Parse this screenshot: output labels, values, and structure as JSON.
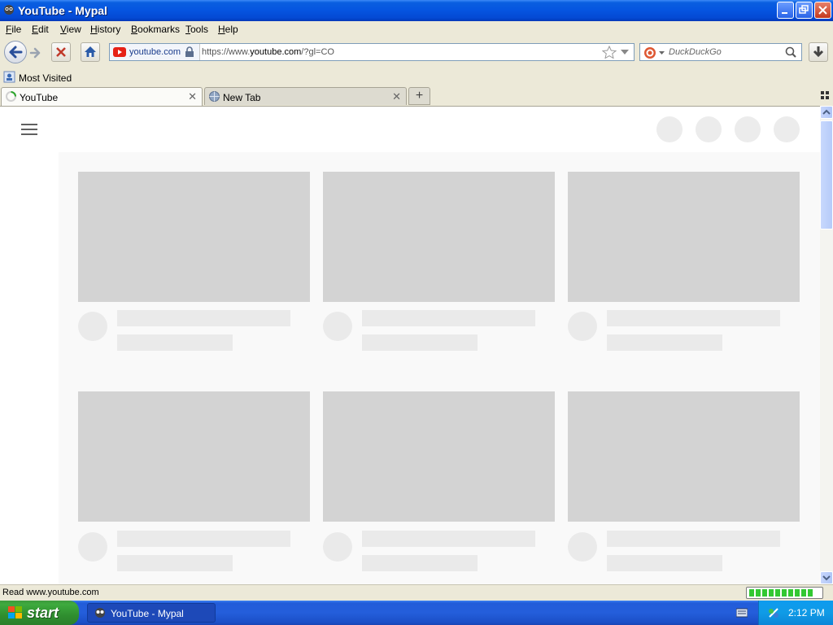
{
  "window": {
    "title": "YouTube - Mypal"
  },
  "menu": [
    {
      "label": "File",
      "key": "F",
      "rest": "ile"
    },
    {
      "label": "Edit",
      "key": "E",
      "rest": "dit"
    },
    {
      "label": "View",
      "key": "V",
      "rest": "iew"
    },
    {
      "label": "History",
      "key": "H",
      "rest": "istory"
    },
    {
      "label": "Bookmarks",
      "key": "B",
      "rest": "ookmarks"
    },
    {
      "label": "Tools",
      "key": "T",
      "rest": "ools"
    },
    {
      "label": "Help",
      "key": "H",
      "rest": "elp"
    }
  ],
  "navbar": {
    "identity_label": "youtube.com",
    "url_prefix": "https://www.",
    "url_domain": "youtube.com",
    "url_suffix": "/?gl=CO",
    "search_placeholder": "DuckDuckGo"
  },
  "bookmarks": {
    "most_visited": "Most Visited"
  },
  "tabs": [
    {
      "label": "YouTube",
      "active": true
    },
    {
      "label": "New Tab",
      "active": false
    }
  ],
  "status": {
    "text": "Read www.youtube.com",
    "progress_segments_filled": 10
  },
  "taskbar": {
    "start_label": "start",
    "task_label": "YouTube - Mypal",
    "clock": "2:12 PM"
  },
  "colors": {
    "accent": "#0554e0",
    "start_green": "#3eaa3e",
    "skeleton": "#d3d3d3"
  },
  "icons": {
    "back": "arrow-left-icon",
    "forward": "arrow-right-icon",
    "stop": "close-x-icon",
    "home": "home-icon",
    "star": "star-icon",
    "search": "magnifier-icon",
    "download": "download-arrow-icon"
  }
}
